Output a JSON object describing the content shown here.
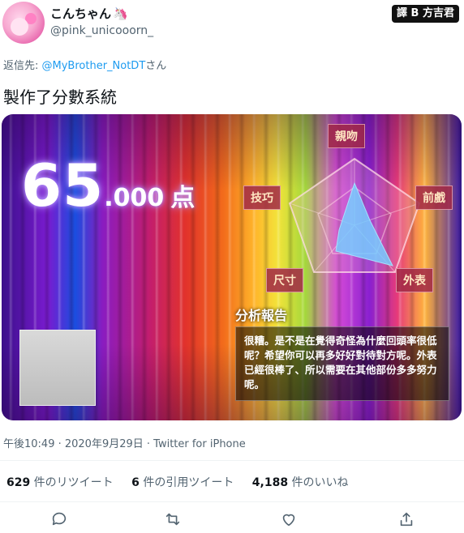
{
  "tweet": {
    "display_name": "こんちゃん",
    "name_icon": "unicorn-icon",
    "handle": "@pink_unicooorn_",
    "badge": "譯 B 方吉君",
    "reply_prefix": "返信先: ",
    "reply_to": "@MyBrother_NotDT",
    "reply_suffix": "さん",
    "text": "製作了分數系統",
    "timestamp": "午後10:49 · 2020年9月29日 · Twitter for iPhone"
  },
  "card": {
    "score_int": "65",
    "score_dec": ".000",
    "score_unit": "点",
    "labels": {
      "top": "親吻",
      "right_upper": "前戲",
      "right_lower": "外表",
      "left_lower": "尺寸",
      "left_upper": "技巧"
    },
    "report_title": "分析報告",
    "report_text": "很糟。是不是在覺得奇怪為什麼回頭率很低呢？希望你可以再多好好對待對方呢。外表已經很棒了、所以需要在其他部份多多努力呢。"
  },
  "stats": {
    "retweets_count": "629",
    "retweets_label": " 件のリツイート",
    "quotes_count": "6",
    "quotes_label": " 件の引用ツイート",
    "likes_count": "4,188",
    "likes_label": " 件のいいね"
  },
  "actions": [
    "reply-icon",
    "retweet-icon",
    "like-icon",
    "share-icon"
  ]
}
